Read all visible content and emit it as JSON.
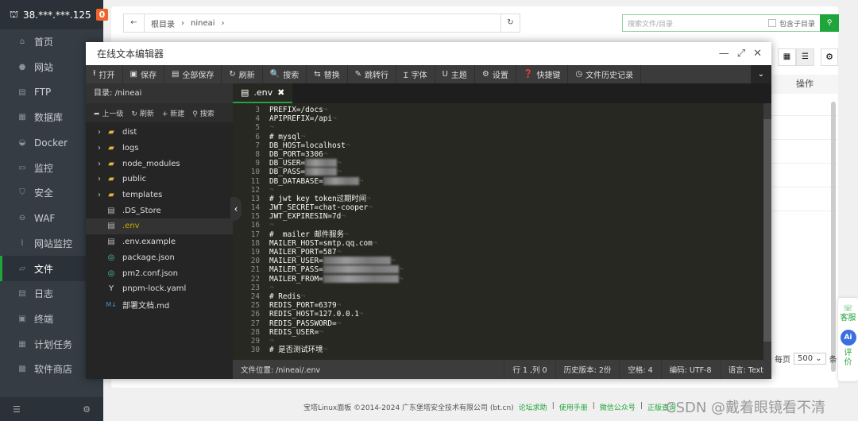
{
  "sidebar": {
    "server": "38.***.***.125",
    "badge": "0",
    "items": [
      {
        "label": "首页",
        "icon": "home-icon",
        "glyph": "⌂"
      },
      {
        "label": "网站",
        "icon": "globe-icon",
        "glyph": "●"
      },
      {
        "label": "FTP",
        "icon": "ftp-icon",
        "glyph": "▤"
      },
      {
        "label": "数据库",
        "icon": "database-icon",
        "glyph": "▦"
      },
      {
        "label": "Docker",
        "icon": "docker-icon",
        "glyph": "◒"
      },
      {
        "label": "监控",
        "icon": "monitor-icon",
        "glyph": "▭"
      },
      {
        "label": "安全",
        "icon": "shield-icon",
        "glyph": "⛉"
      },
      {
        "label": "WAF",
        "icon": "waf-icon",
        "glyph": "⊖"
      },
      {
        "label": "网站监控",
        "icon": "chart-icon",
        "glyph": "⌇"
      },
      {
        "label": "文件",
        "icon": "folder-icon",
        "glyph": "▱",
        "active": true
      },
      {
        "label": "日志",
        "icon": "log-icon",
        "glyph": "▤"
      },
      {
        "label": "终端",
        "icon": "terminal-icon",
        "glyph": "▣"
      },
      {
        "label": "计划任务",
        "icon": "calendar-icon",
        "glyph": "▦"
      },
      {
        "label": "软件商店",
        "icon": "apps-icon",
        "glyph": "▩"
      }
    ]
  },
  "filemgr": {
    "crumbs": [
      "根目录",
      "nineai"
    ],
    "search_placeholder": "搜索文件/目录",
    "include_sub": "包含子目录",
    "col_action": "操作",
    "per_page_label": "每页",
    "per_page": "500",
    "per_page_unit": "条"
  },
  "float": {
    "service": "客服",
    "review": "评价",
    "ai": "Ai"
  },
  "footer": {
    "copyright": "宝塔Linux面板 ©2014-2024 广东堡塔安全技术有限公司 (bt.cn)",
    "links": [
      "论坛求助",
      "使用手册",
      "微信公众号",
      "正版查询"
    ]
  },
  "watermark": "CSDN @戴着眼镜看不清",
  "editor": {
    "title": "在线文本编辑器",
    "toolbar": [
      {
        "label": "打开",
        "g": "⭱"
      },
      {
        "label": "保存",
        "g": "▣"
      },
      {
        "label": "全部保存",
        "g": "▤"
      },
      {
        "label": "刷新",
        "g": "↻"
      },
      {
        "label": "搜索",
        "g": "🔍"
      },
      {
        "label": "替换",
        "g": "⇆"
      },
      {
        "label": "跳转行",
        "g": "✎"
      },
      {
        "label": "字体",
        "g": "Ɪ"
      },
      {
        "label": "主题",
        "g": "U"
      },
      {
        "label": "设置",
        "g": "⚙"
      },
      {
        "label": "快捷键",
        "g": "❓"
      },
      {
        "label": "文件历史记录",
        "g": "◷"
      }
    ],
    "dir_label": "目录:",
    "dir": "/nineai",
    "actions": [
      {
        "label": "上一级",
        "g": "➦"
      },
      {
        "label": "刷新",
        "g": "↻"
      },
      {
        "label": "新建",
        "g": "+"
      },
      {
        "label": "搜索",
        "g": "⚲"
      }
    ],
    "files": [
      {
        "name": "dist",
        "type": "folder"
      },
      {
        "name": "logs",
        "type": "folder"
      },
      {
        "name": "node_modules",
        "type": "folder"
      },
      {
        "name": "public",
        "type": "folder"
      },
      {
        "name": "templates",
        "type": "folder"
      },
      {
        "name": ".DS_Store",
        "type": "file"
      },
      {
        "name": ".env",
        "type": "file",
        "selected": true
      },
      {
        "name": ".env.example",
        "type": "file"
      },
      {
        "name": "package.json",
        "type": "json"
      },
      {
        "name": "pm2.conf.json",
        "type": "json"
      },
      {
        "name": "pnpm-lock.yaml",
        "type": "yaml"
      },
      {
        "name": "部署文档.md",
        "type": "md"
      }
    ],
    "tab": ".env",
    "lines": [
      {
        "n": "3",
        "t": "PREFIX=/docs"
      },
      {
        "n": "4",
        "t": "APIPREFIX=/api"
      },
      {
        "n": "5",
        "t": ""
      },
      {
        "n": "6",
        "t": "# mysql"
      },
      {
        "n": "7",
        "t": "DB_HOST=localhost"
      },
      {
        "n": "8",
        "t": "DB_PORT=3306"
      },
      {
        "n": "9",
        "t": "DB_USER=",
        "r": 40
      },
      {
        "n": "10",
        "t": "DB_PASS=",
        "r": 40
      },
      {
        "n": "11",
        "t": "DB_DATABASE=",
        "r": 45
      },
      {
        "n": "12",
        "t": ""
      },
      {
        "n": "13",
        "t": "# jwt key token过期时间"
      },
      {
        "n": "14",
        "t": "JWT_SECRET=chat-cooper"
      },
      {
        "n": "15",
        "t": "JWT_EXPIRESIN=7d"
      },
      {
        "n": "16",
        "t": ""
      },
      {
        "n": "17",
        "t": "#  mailer 邮件服务"
      },
      {
        "n": "18",
        "t": "MAILER_HOST=smtp.qq.com"
      },
      {
        "n": "19",
        "t": "MAILER_PORT=587"
      },
      {
        "n": "20",
        "t": "MAILER_USER=",
        "r": 85
      },
      {
        "n": "21",
        "t": "MAILER_PASS=",
        "r": 95
      },
      {
        "n": "22",
        "t": "MAILER_FROM=",
        "r": 95
      },
      {
        "n": "23",
        "t": ""
      },
      {
        "n": "24",
        "t": "# Redis"
      },
      {
        "n": "25",
        "t": "REDIS_PORT=6379"
      },
      {
        "n": "26",
        "t": "REDIS_HOST=127.0.0.1"
      },
      {
        "n": "27",
        "t": "REDIS_PASSWORD="
      },
      {
        "n": "28",
        "t": "REDIS_USER="
      },
      {
        "n": "29",
        "t": ""
      },
      {
        "n": "30",
        "t": "# 是否测试环境"
      }
    ],
    "status": {
      "path": "文件位置: /nineai/.env",
      "cursor": "行 1 ,列 0",
      "history": "历史版本: 2份",
      "indent": "空格: 4",
      "encoding": "编码: UTF-8",
      "lang": "语言: Text"
    }
  }
}
